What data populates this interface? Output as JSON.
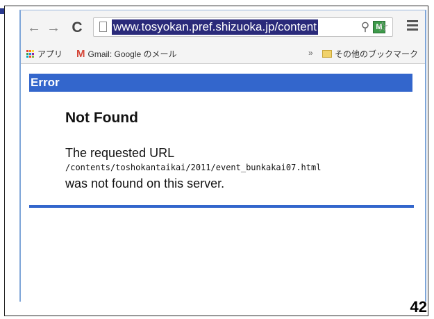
{
  "browser": {
    "url": "www.tosyokan.pref.shizuoka.jp/content",
    "nav": {
      "back": "←",
      "forward": "→",
      "reload": "C"
    },
    "icons": {
      "zoom": "search-icon",
      "extension": "extension-icon",
      "star": "☆",
      "menu": "hamburger-menu-icon"
    },
    "extension_glyph": "M"
  },
  "bookmarks": {
    "apps_label": "アプリ",
    "gmail_label": "Gmail: Google のメール",
    "gmail_glyph": "M",
    "chevron": "»",
    "other_label": "その他のブックマーク",
    "apps_colors": [
      "#e53935",
      "#fb8c00",
      "#fdd835",
      "#43a047",
      "#1e88e5",
      "#8e24aa",
      "#00acc1",
      "#f4511e",
      "#7cb342"
    ]
  },
  "page": {
    "error_title": "Error",
    "heading": "Not Found",
    "requested_label": "The requested URL",
    "path": "/contents/toshokantaikai/2011/event_bunkakai07.html",
    "not_found_msg": "was not found on this server.",
    "accent_color": "#3366cc"
  },
  "slide": {
    "page_number": "42"
  }
}
